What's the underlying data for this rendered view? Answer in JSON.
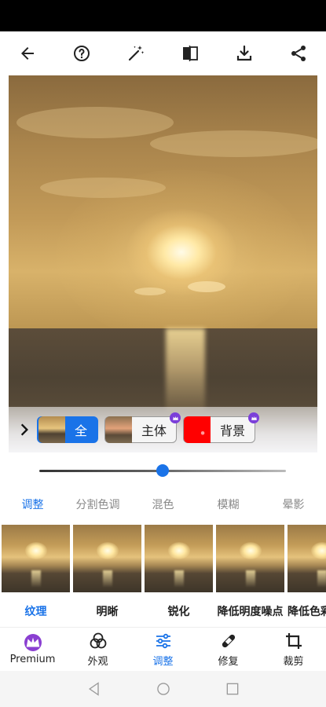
{
  "toolbar": {
    "icons": [
      "back-arrow-icon",
      "help-icon",
      "magic-wand-icon",
      "compare-icon",
      "download-icon",
      "share-icon"
    ]
  },
  "mask_selector": {
    "options": [
      {
        "label": "全",
        "selected": true,
        "premium": false
      },
      {
        "label": "主体",
        "selected": false,
        "premium": true
      },
      {
        "label": "背景",
        "selected": false,
        "premium": true
      }
    ]
  },
  "slider": {
    "value": 0.5
  },
  "category_tabs": [
    {
      "label": "调整",
      "active": true
    },
    {
      "label": "分割色调",
      "active": false
    },
    {
      "label": "混色",
      "active": false
    },
    {
      "label": "模糊",
      "active": false
    },
    {
      "label": "晕影",
      "active": false
    }
  ],
  "tools": [
    {
      "label": "纹理",
      "active": true
    },
    {
      "label": "明晰",
      "active": false
    },
    {
      "label": "锐化",
      "active": false
    },
    {
      "label": "降低明度噪点",
      "active": false
    },
    {
      "label": "降低色彩",
      "active": false
    }
  ],
  "bottom_nav": [
    {
      "label": "Premium",
      "icon": "crown-icon",
      "active": false
    },
    {
      "label": "外观",
      "icon": "looks-circles-icon",
      "active": false
    },
    {
      "label": "调整",
      "icon": "sliders-icon",
      "active": true
    },
    {
      "label": "修复",
      "icon": "bandage-icon",
      "active": false
    },
    {
      "label": "裁剪",
      "icon": "crop-icon",
      "active": false
    }
  ],
  "colors": {
    "accent": "#1a73e8",
    "premium": "#7b3fd9"
  }
}
